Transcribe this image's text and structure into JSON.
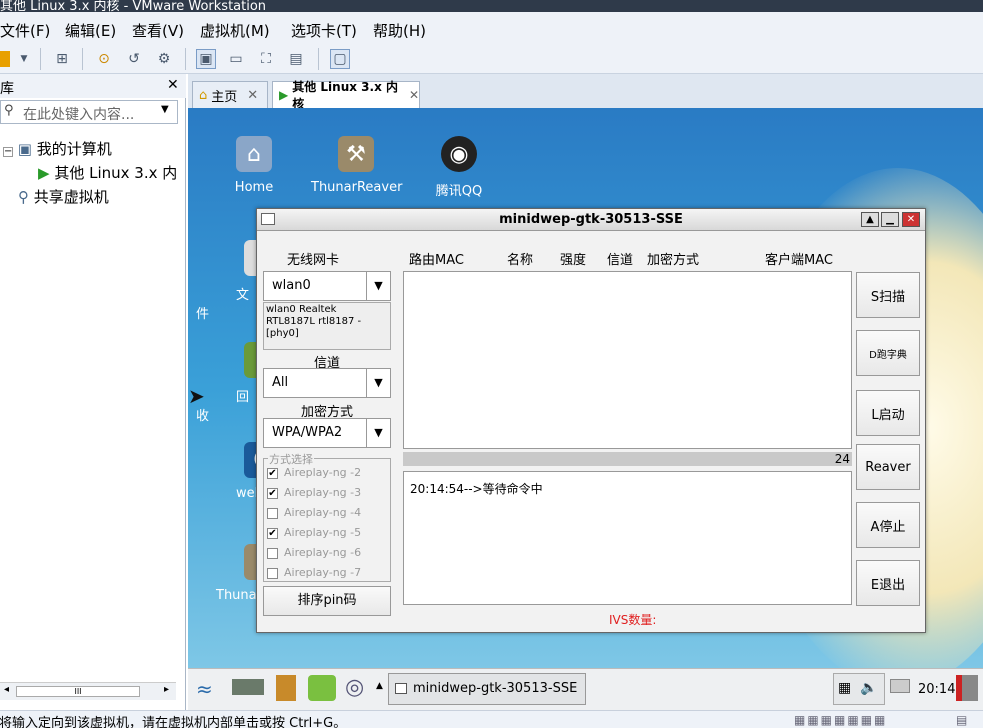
{
  "window": {
    "title": "其他 Linux 3.x 内核 - VMware Workstation"
  },
  "menubar": {
    "file": "文件(F)",
    "edit": "编辑(E)",
    "view": "查看(V)",
    "vm": "虚拟机(M)",
    "tabs": "选项卡(T)",
    "help": "帮助(H)"
  },
  "library": {
    "title": "库",
    "search_placeholder": "在此处键入内容...",
    "my_computer": "我的计算机",
    "vm_item": "其他 Linux 3.x 内",
    "shared": "共享虚拟机"
  },
  "tabs": [
    {
      "label": "主页"
    },
    {
      "label": "其他 Linux 3.x 内核"
    }
  ],
  "desktop": {
    "icons": [
      {
        "label": "Home"
      },
      {
        "label": "ThunarReaver"
      },
      {
        "label": "腾讯QQ"
      },
      {
        "label": "文件"
      },
      {
        "label": "回收"
      },
      {
        "label": "web"
      },
      {
        "label": "Thuna"
      }
    ]
  },
  "app": {
    "title": "minidwep-gtk-30513-SSE",
    "wireless_label": "无线网卡",
    "wireless_value": "wlan0",
    "wireless_info": "wlan0 Realtek RTL8187L rtl8187 - [phy0]",
    "channel_label": "信道",
    "channel_value": "All",
    "encryption_label": "加密方式",
    "encryption_value": "WPA/WPA2",
    "mode_label": "方式选择",
    "modes": [
      {
        "label": "Aireplay-ng -2",
        "checked": true
      },
      {
        "label": "Aireplay-ng -3",
        "checked": true
      },
      {
        "label": "Aireplay-ng -4",
        "checked": false
      },
      {
        "label": "Aireplay-ng -5",
        "checked": true
      },
      {
        "label": "Aireplay-ng -6",
        "checked": false
      },
      {
        "label": "Aireplay-ng -7",
        "checked": false
      }
    ],
    "sort_pin_button": "排序pin码",
    "columns": {
      "router_mac": "路由MAC",
      "name": "名称",
      "strength": "强度",
      "channel": "信道",
      "encryption": "加密方式",
      "client_mac": "客户端MAC"
    },
    "count": "24",
    "log": "20:14:54-->等待命令中",
    "ivs_label": "IVS数量:",
    "buttons": {
      "scan": "S扫描",
      "dict": "D跑字典",
      "launch": "L启动",
      "reaver": "Reaver",
      "stop": "A停止",
      "exit": "E退出"
    }
  },
  "taskbar": {
    "task": "minidwep-gtk-30513-SSE",
    "clock": "20:14"
  },
  "statusbar": {
    "text": "要将输入定向到该虚拟机，请在虚拟机内部单击或按 Ctrl+G。"
  }
}
